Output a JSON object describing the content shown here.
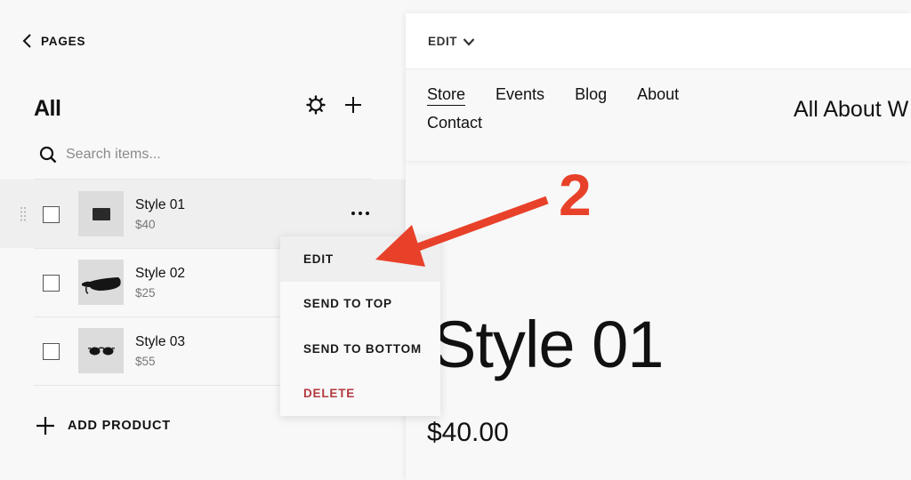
{
  "sidebar": {
    "back_label": "PAGES",
    "title": "All",
    "search": {
      "placeholder": "Search items...",
      "value": ""
    },
    "products": [
      {
        "name": "Style 01",
        "price": "$40",
        "image": "wallet",
        "selected": true
      },
      {
        "name": "Style 02",
        "price": "$25",
        "image": "belt-bag",
        "selected": false
      },
      {
        "name": "Style 03",
        "price": "$55",
        "image": "sunglasses",
        "selected": false
      }
    ],
    "add_product_label": "ADD PRODUCT"
  },
  "context_menu": {
    "items": [
      {
        "label": "EDIT",
        "state": "hover"
      },
      {
        "label": "SEND TO TOP"
      },
      {
        "label": "SEND TO BOTTOM"
      },
      {
        "label": "DELETE",
        "variant": "danger"
      }
    ],
    "danger_color": "#b3393f"
  },
  "preview": {
    "edit_label": "EDIT",
    "nav": [
      "Store",
      "Events",
      "Blog",
      "About",
      "Contact"
    ],
    "active_nav": "Store",
    "site_title": "All About W",
    "product_title": "Style 01",
    "product_price": "$40.00"
  },
  "annotation": {
    "step_number": "2",
    "color": "#e8412a"
  }
}
